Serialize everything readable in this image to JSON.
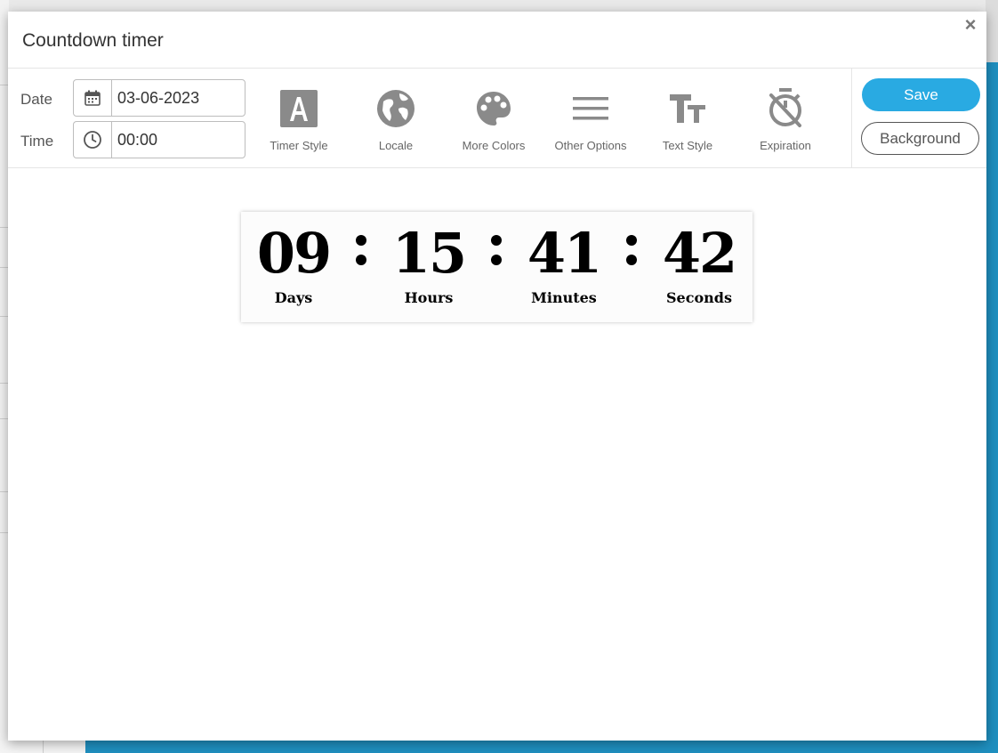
{
  "modal": {
    "title": "Countdown timer",
    "close_symbol": "×"
  },
  "form": {
    "date_label": "Date",
    "date_value": "03-06-2023",
    "date_icon": "calendar-icon",
    "time_label": "Time",
    "time_value": "00:00",
    "time_icon": "clock-icon"
  },
  "toolbar": {
    "tools": [
      {
        "label": "Timer Style",
        "icon": "letter-a-icon"
      },
      {
        "label": "Locale",
        "icon": "globe-icon"
      },
      {
        "label": "More Colors",
        "icon": "palette-icon"
      },
      {
        "label": "Other Options",
        "icon": "menu-lines-icon"
      },
      {
        "label": "Text Style",
        "icon": "text-size-icon"
      },
      {
        "label": "Expiration",
        "icon": "timer-off-icon"
      }
    ],
    "save_label": "Save",
    "background_label": "Background"
  },
  "timer": {
    "days": "09",
    "days_label": "Days",
    "hours": "15",
    "hours_label": "Hours",
    "minutes": "41",
    "minutes_label": "Minutes",
    "seconds": "42",
    "seconds_label": "Seconds"
  },
  "colors": {
    "accent": "#29aae2",
    "icon_gray": "#8a8a8a",
    "page_background": "#1f8fbf"
  }
}
